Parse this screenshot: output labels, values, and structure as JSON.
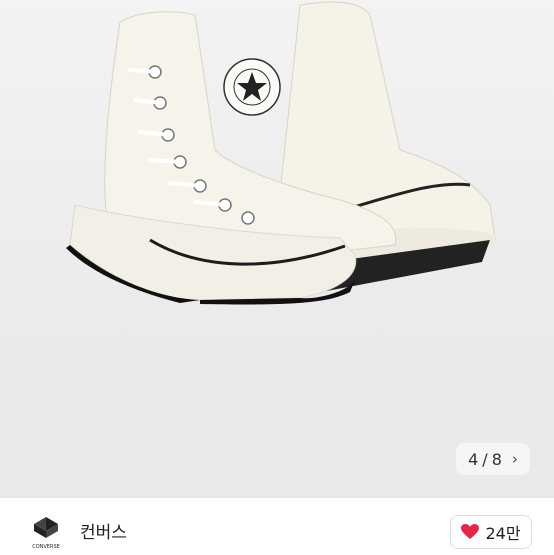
{
  "gallery": {
    "image_alt": "Converse Run Star Legacy CX high-top sneakers in white",
    "current": "4",
    "separator": "/",
    "total": "8",
    "next_icon": "chevron-right-icon"
  },
  "seller": {
    "logo_text": "CONVERSE",
    "name": "컨버스",
    "likes": "24만",
    "like_icon": "heart-icon",
    "heart_color": "#e0284b"
  }
}
